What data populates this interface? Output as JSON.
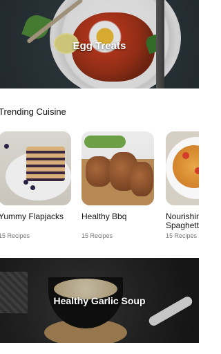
{
  "hero": {
    "title": "Egg Treats"
  },
  "trending": {
    "title": "Trending Cuisine",
    "cards": [
      {
        "name": "Yummy Flapjacks",
        "count": "15 Recipes"
      },
      {
        "name": "Healthy Bbq",
        "count": "15 Recipes"
      },
      {
        "name": "Nourishing Spaghetti",
        "count": "15 Recipes"
      }
    ]
  },
  "banner2": {
    "title": "Healthy Garlic Soup"
  }
}
